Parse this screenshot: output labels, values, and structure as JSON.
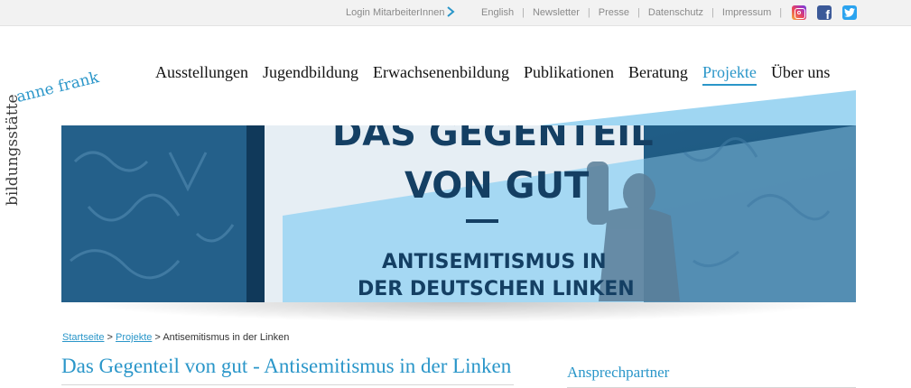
{
  "topbar": {
    "login_label": "Login MitarbeiterInnen",
    "links": [
      {
        "label": "English"
      },
      {
        "label": "Newsletter"
      },
      {
        "label": "Presse"
      },
      {
        "label": "Datenschutz"
      },
      {
        "label": "Impressum"
      }
    ],
    "separator": "|",
    "social": [
      "instagram-icon",
      "facebook-icon",
      "twitter-icon"
    ]
  },
  "logo": {
    "line1": "bildungsstätte",
    "line2": "anne frank"
  },
  "nav": {
    "items": [
      {
        "label": "Ausstellungen"
      },
      {
        "label": "Jugendbildung"
      },
      {
        "label": "Erwachsenenbildung"
      },
      {
        "label": "Publikationen"
      },
      {
        "label": "Beratung"
      },
      {
        "label": "Projekte",
        "active": true
      },
      {
        "label": "Über uns"
      }
    ]
  },
  "hero": {
    "line1": "DAS GEGENTEIL",
    "line2": "VON GUT",
    "line3": "ANTISEMITISMUS IN",
    "line4": "DER DEUTSCHEN LINKEN"
  },
  "breadcrumb": {
    "home": "Startseite",
    "sep1": " > ",
    "parent": "Projekte",
    "sep2": " > ",
    "current": "Antisemitismus in der Linken"
  },
  "main": {
    "title": "Das Gegenteil von gut - Antisemitismus in der Linken"
  },
  "sidebar": {
    "title": "Ansprechpartner"
  },
  "colors": {
    "accent": "#2a96c9",
    "hero_dark": "#1f5d86",
    "hero_light": "#9fd6f2"
  }
}
